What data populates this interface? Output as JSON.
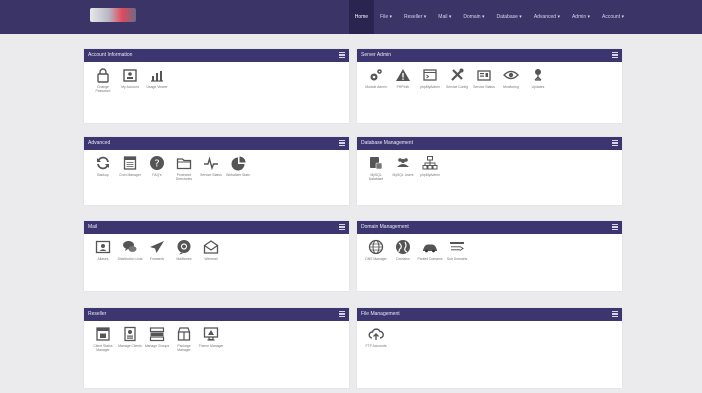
{
  "header": {
    "logo_alt": "logo",
    "nav": [
      {
        "label": "Home"
      },
      {
        "label": "File ▾"
      },
      {
        "label": "Reseller ▾"
      },
      {
        "label": "Mail ▾"
      },
      {
        "label": "Domain ▾"
      },
      {
        "label": "Database ▾"
      },
      {
        "label": "Advanced ▾"
      },
      {
        "label": "Admin ▾"
      },
      {
        "label": "Account ▾"
      }
    ]
  },
  "panels": {
    "account": {
      "title": "Account Information",
      "items": [
        {
          "label": "Change Password",
          "icon": "lock-icon"
        },
        {
          "label": "My Account",
          "icon": "id-card-icon"
        },
        {
          "label": "Usage Viewer",
          "icon": "bar-chart-icon"
        }
      ]
    },
    "server": {
      "title": "Server Admin",
      "items": [
        {
          "label": "Module Admin",
          "icon": "gears-icon"
        },
        {
          "label": "PHPInfo",
          "icon": "warning-icon"
        },
        {
          "label": "phpMyAdmin",
          "icon": "terminal-icon"
        },
        {
          "label": "Service Config",
          "icon": "tools-icon"
        },
        {
          "label": "Service Status",
          "icon": "server-icon"
        },
        {
          "label": "Monitoring",
          "icon": "eye-icon"
        },
        {
          "label": "Updates",
          "icon": "network-icon"
        }
      ]
    },
    "advanced": {
      "title": "Advanced",
      "items": [
        {
          "label": "Backup",
          "icon": "sync-icon"
        },
        {
          "label": "Cron Manager",
          "icon": "calendar-icon"
        },
        {
          "label": "FAQ's",
          "icon": "question-icon"
        },
        {
          "label": "Protected Directories",
          "icon": "folder-icon"
        },
        {
          "label": "Service Status",
          "icon": "pulse-icon"
        },
        {
          "label": "Webalizer Stats",
          "icon": "pie-chart-icon"
        }
      ]
    },
    "database": {
      "title": "Database Management",
      "items": [
        {
          "label": "MySQL Database",
          "icon": "database-icon"
        },
        {
          "label": "MySQL Users",
          "icon": "users-icon"
        },
        {
          "label": "phpMyAdmin",
          "icon": "sitemap-icon"
        }
      ]
    },
    "mail": {
      "title": "Mail",
      "items": [
        {
          "label": "Aliases",
          "icon": "contact-card-icon"
        },
        {
          "label": "Distribution Lists",
          "icon": "chat-icon"
        },
        {
          "label": "Forwards",
          "icon": "send-icon"
        },
        {
          "label": "Mailboxes",
          "icon": "at-sign-icon"
        },
        {
          "label": "Webmail",
          "icon": "envelope-icon"
        }
      ]
    },
    "domain": {
      "title": "Domain Management",
      "items": [
        {
          "label": "DNS Manager",
          "icon": "globe-icon"
        },
        {
          "label": "Domains",
          "icon": "earth-icon"
        },
        {
          "label": "Parked Domains",
          "icon": "car-icon"
        },
        {
          "label": "Sub Domains",
          "icon": "subdomain-icon"
        }
      ]
    },
    "reseller": {
      "title": "Reseller",
      "items": [
        {
          "label": "Client Status Manager",
          "icon": "calendar-status-icon"
        },
        {
          "label": "Manage Clients",
          "icon": "user-card-icon"
        },
        {
          "label": "Manage Groups",
          "icon": "layers-icon"
        },
        {
          "label": "Package Manager",
          "icon": "package-icon"
        },
        {
          "label": "Theme Manager",
          "icon": "monitor-icon"
        }
      ]
    },
    "files": {
      "title": "File Management",
      "items": [
        {
          "label": "FTP Accounts",
          "icon": "cloud-upload-icon"
        }
      ]
    }
  },
  "colors": {
    "topbar": "#3a3467",
    "panel_header": "#3c3670",
    "icon": "#555555",
    "background": "#ebebed"
  }
}
